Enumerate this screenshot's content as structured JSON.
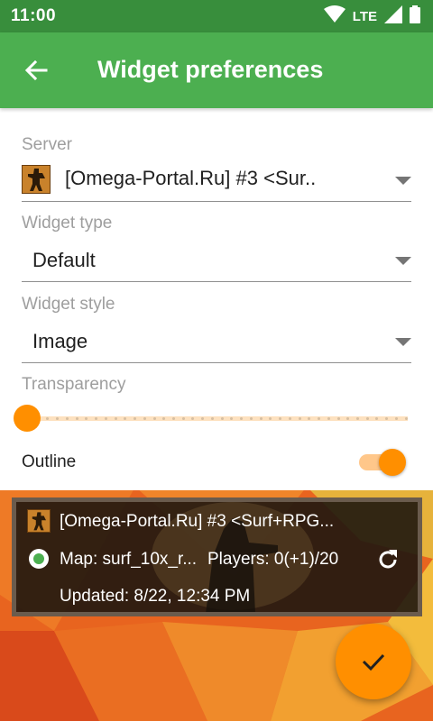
{
  "status_bar": {
    "time": "11:00",
    "network_label": "LTE",
    "icons": [
      "wifi-icon",
      "signal-icon",
      "battery-icon"
    ]
  },
  "app_bar": {
    "title": "Widget preferences",
    "back_icon": "arrow-back-icon"
  },
  "form": {
    "server": {
      "label": "Server",
      "value": "[Omega-Portal.Ru] #3 <Sur..",
      "icon": "game-server-icon"
    },
    "widget_type": {
      "label": "Widget type",
      "value": "Default"
    },
    "widget_style": {
      "label": "Widget style",
      "value": "Image"
    },
    "transparency": {
      "label": "Transparency",
      "value": 0
    },
    "outline": {
      "label": "Outline",
      "enabled": true
    }
  },
  "widget_preview": {
    "title": "[Omega-Portal.Ru] #3 <Surf+RPG...",
    "map": "Map: surf_10x_r...",
    "players": "Players: 0(+1)/20",
    "updated": "Updated: 8/22, 12:34 PM",
    "status": "online"
  },
  "fab": {
    "icon": "check-icon"
  },
  "colors": {
    "status_bar": "#388e3c",
    "app_bar": "#4caf50",
    "accent": "#ff8f00",
    "online": "#4caf50"
  }
}
